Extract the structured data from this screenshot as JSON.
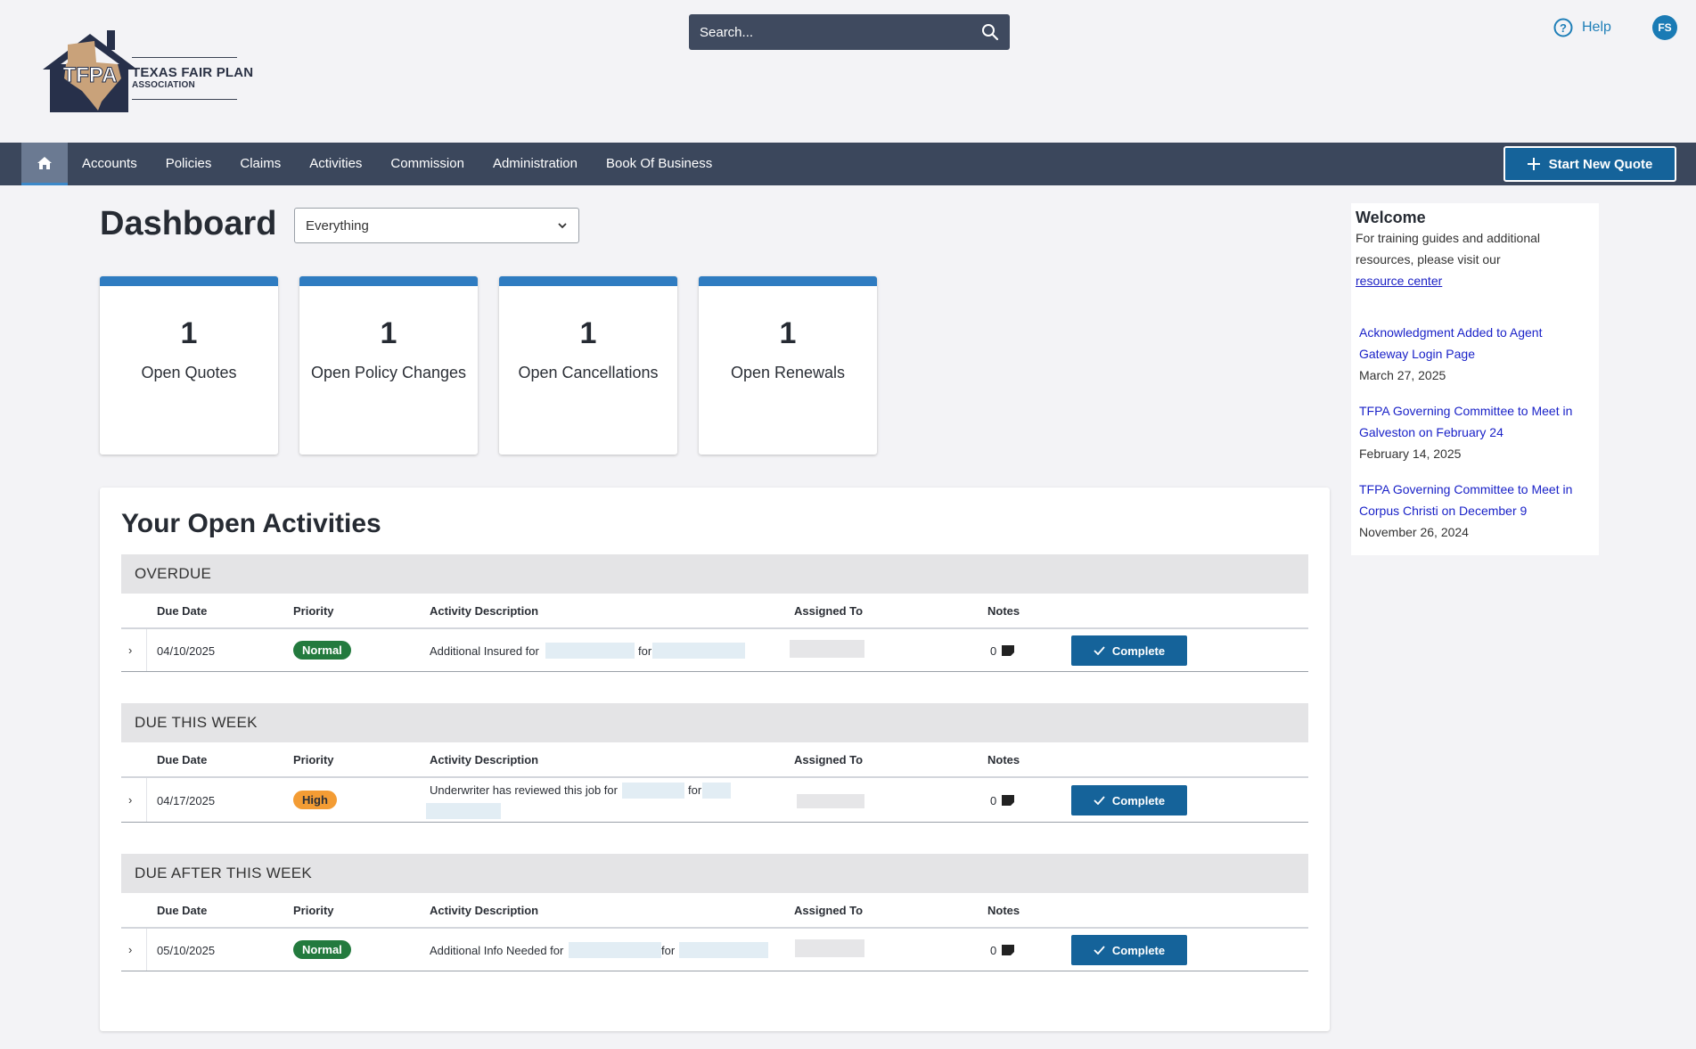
{
  "brand": {
    "logo_mark": "TFPA",
    "logo_name": "TEXAS FAIR PLAN",
    "logo_sub": "ASSOCIATION"
  },
  "search": {
    "placeholder": "Search..."
  },
  "header": {
    "help_label": "Help",
    "user_initials": "FS"
  },
  "nav": {
    "items": [
      "Accounts",
      "Policies",
      "Claims",
      "Activities",
      "Commission",
      "Administration",
      "Book Of Business"
    ],
    "start_quote_label": "Start New Quote"
  },
  "dashboard": {
    "title": "Dashboard",
    "filter_value": "Everything",
    "cards": [
      {
        "count": "1",
        "label": "Open Quotes"
      },
      {
        "count": "1",
        "label": "Open Policy Changes"
      },
      {
        "count": "1",
        "label": "Open Cancellations"
      },
      {
        "count": "1",
        "label": "Open Renewals"
      }
    ]
  },
  "activities": {
    "title": "Your Open Activities",
    "columns": [
      "Due Date",
      "Priority",
      "Activity Description",
      "Assigned To",
      "Notes"
    ],
    "complete_label": "Complete",
    "groups": [
      {
        "heading": "OVERDUE",
        "rows": [
          {
            "due_date": "04/10/2025",
            "priority": "Normal",
            "desc_start": "Additional Insured for",
            "desc_mid": "for",
            "notes": "0"
          }
        ]
      },
      {
        "heading": "DUE THIS WEEK",
        "rows": [
          {
            "due_date": "04/17/2025",
            "priority": "High",
            "desc_start": "Underwriter has reviewed this job for",
            "desc_mid": "for",
            "notes": "0"
          }
        ]
      },
      {
        "heading": "DUE AFTER THIS WEEK",
        "rows": [
          {
            "due_date": "05/10/2025",
            "priority": "Normal",
            "desc_start": "Additional Info Needed for",
            "desc_mid": "for",
            "notes": "0"
          }
        ]
      }
    ]
  },
  "sidebar": {
    "welcome_title": "Welcome",
    "welcome_text": "For training guides and additional resources, please visit our",
    "resource_link": "resource center",
    "news": [
      {
        "title": "Acknowledgment Added to Agent Gateway Login Page",
        "date": "March 27, 2025"
      },
      {
        "title": "TFPA Governing Committee to Meet in Galveston on February 24",
        "date": "February 14, 2025"
      },
      {
        "title": "TFPA Governing Committee to Meet in Corpus Christi on December 9",
        "date": "November 26, 2024"
      }
    ]
  },
  "colors": {
    "nav_bg": "#3b475c",
    "accent": "#15639a",
    "card_top": "#2f7cc1",
    "priority_normal": "#237a3e",
    "priority_high": "#f39c34"
  }
}
